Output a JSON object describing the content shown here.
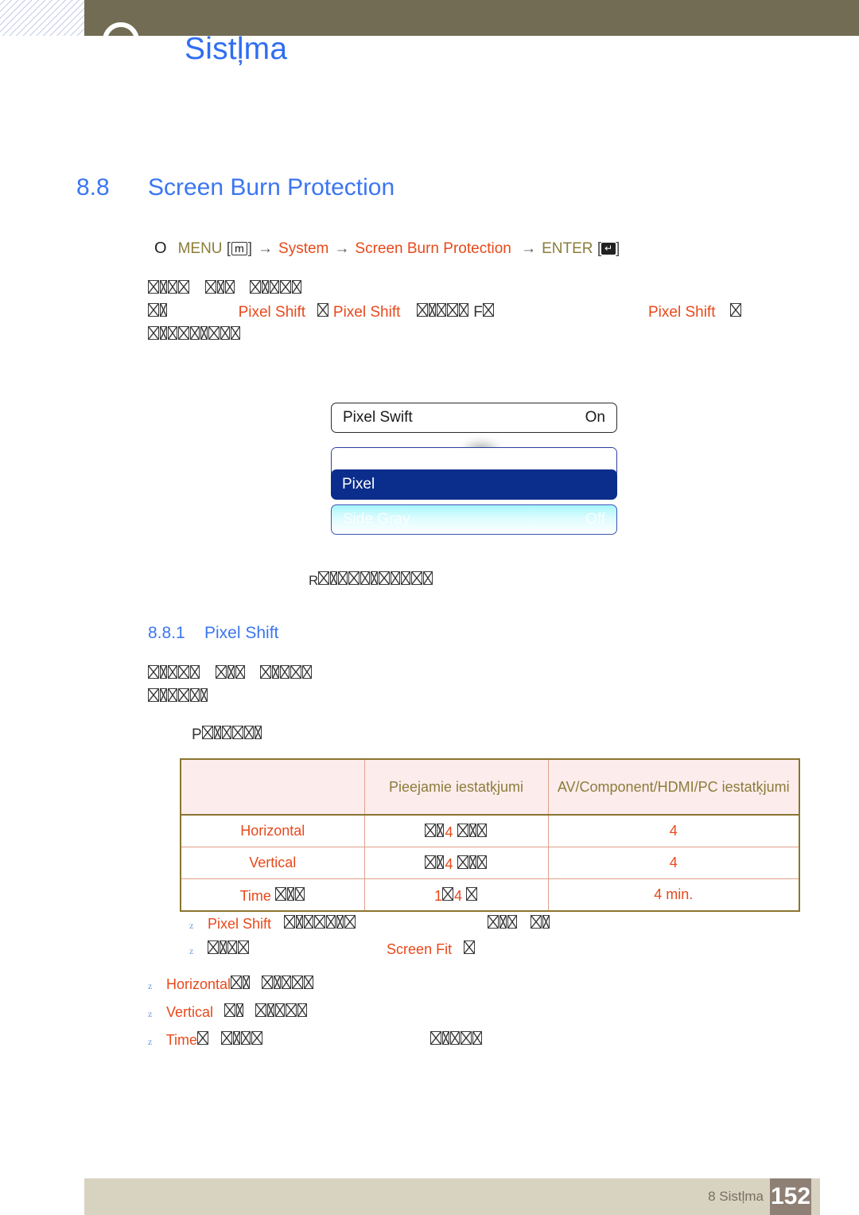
{
  "header": {
    "title": "Sistļma",
    "logo_icon": "circle-logo-icon"
  },
  "section": {
    "number": "8.8",
    "title": "Screen Burn Protection"
  },
  "menu_path": {
    "bullet": "O",
    "menu_label": "MENU",
    "menu_key": "m",
    "arrow": "→",
    "item1": "System",
    "item2": "Screen Burn Protection",
    "enter_label": "ENTER",
    "enter_key": "↵"
  },
  "intro": {
    "line1_tofu": 11,
    "line2_prefix_tofu": 2,
    "line2_a": "Pixel Shift",
    "line2_b": "Pixel Shift",
    "line2_mid_tofu": 5,
    "line2_f": "F",
    "line2_right": "Pixel Shift",
    "line3_tofu": 9
  },
  "osd": {
    "row1_label": "Pixel Swift",
    "row1_value": "On",
    "row3_label": "Pixel",
    "row4_label": "Side Gray",
    "row4_value": "Off",
    "caption_prefix": "R",
    "caption_tofu": 11
  },
  "subsection": {
    "number": "8.8.1",
    "title": "Pixel Shift"
  },
  "sub_body": {
    "line1_tofu": 13,
    "line2_tofu": 6,
    "line3_prefix": "P",
    "line3_tofu": 6
  },
  "table": {
    "headers": [
      "",
      "Pieejamie iestatķjumi",
      "AV/Component/HDMI/PC iestatķjumi"
    ],
    "rows": [
      {
        "label": "Horizontal",
        "label_tofu": 0,
        "available": "4",
        "available_tofu_pre": 2,
        "available_tofu_post": 3,
        "setting": "4"
      },
      {
        "label": "Vertical",
        "label_tofu": 0,
        "available": "4",
        "available_tofu_pre": 2,
        "available_tofu_post": 3,
        "setting": "4"
      },
      {
        "label": "Time",
        "label_tofu": 3,
        "available": "1",
        "available_tofu_pre": 0,
        "available_tofu_post": 0,
        "available_mid": "4",
        "setting": "4 min."
      }
    ]
  },
  "notes": [
    {
      "mark": "z",
      "label": "Pixel Shift",
      "tofu_after": 7,
      "tofu_far": 6
    },
    {
      "mark": "z",
      "label": "",
      "tofu_lead": 4,
      "mid_label": "Screen Fit",
      "tofu_after": 1
    }
  ],
  "bullets": [
    {
      "mark": "z",
      "label": "Horizontal",
      "tofu_after": 7
    },
    {
      "mark": "z",
      "label": "Vertical",
      "tofu_after": 7
    },
    {
      "mark": "z",
      "label": "Time",
      "tofu_after": 5,
      "tofu_far": 6
    }
  ],
  "footer": {
    "chapter": "8 Sistļma",
    "page": "152"
  },
  "colors": {
    "header_band": "#726c55",
    "heading_blue": "#3b76f0",
    "orange": "#e8491b",
    "olive": "#8a7d3a",
    "osd_selected": "#0b2d8c",
    "footer_band": "#d8d2c0",
    "page_box": "#8f8075"
  }
}
